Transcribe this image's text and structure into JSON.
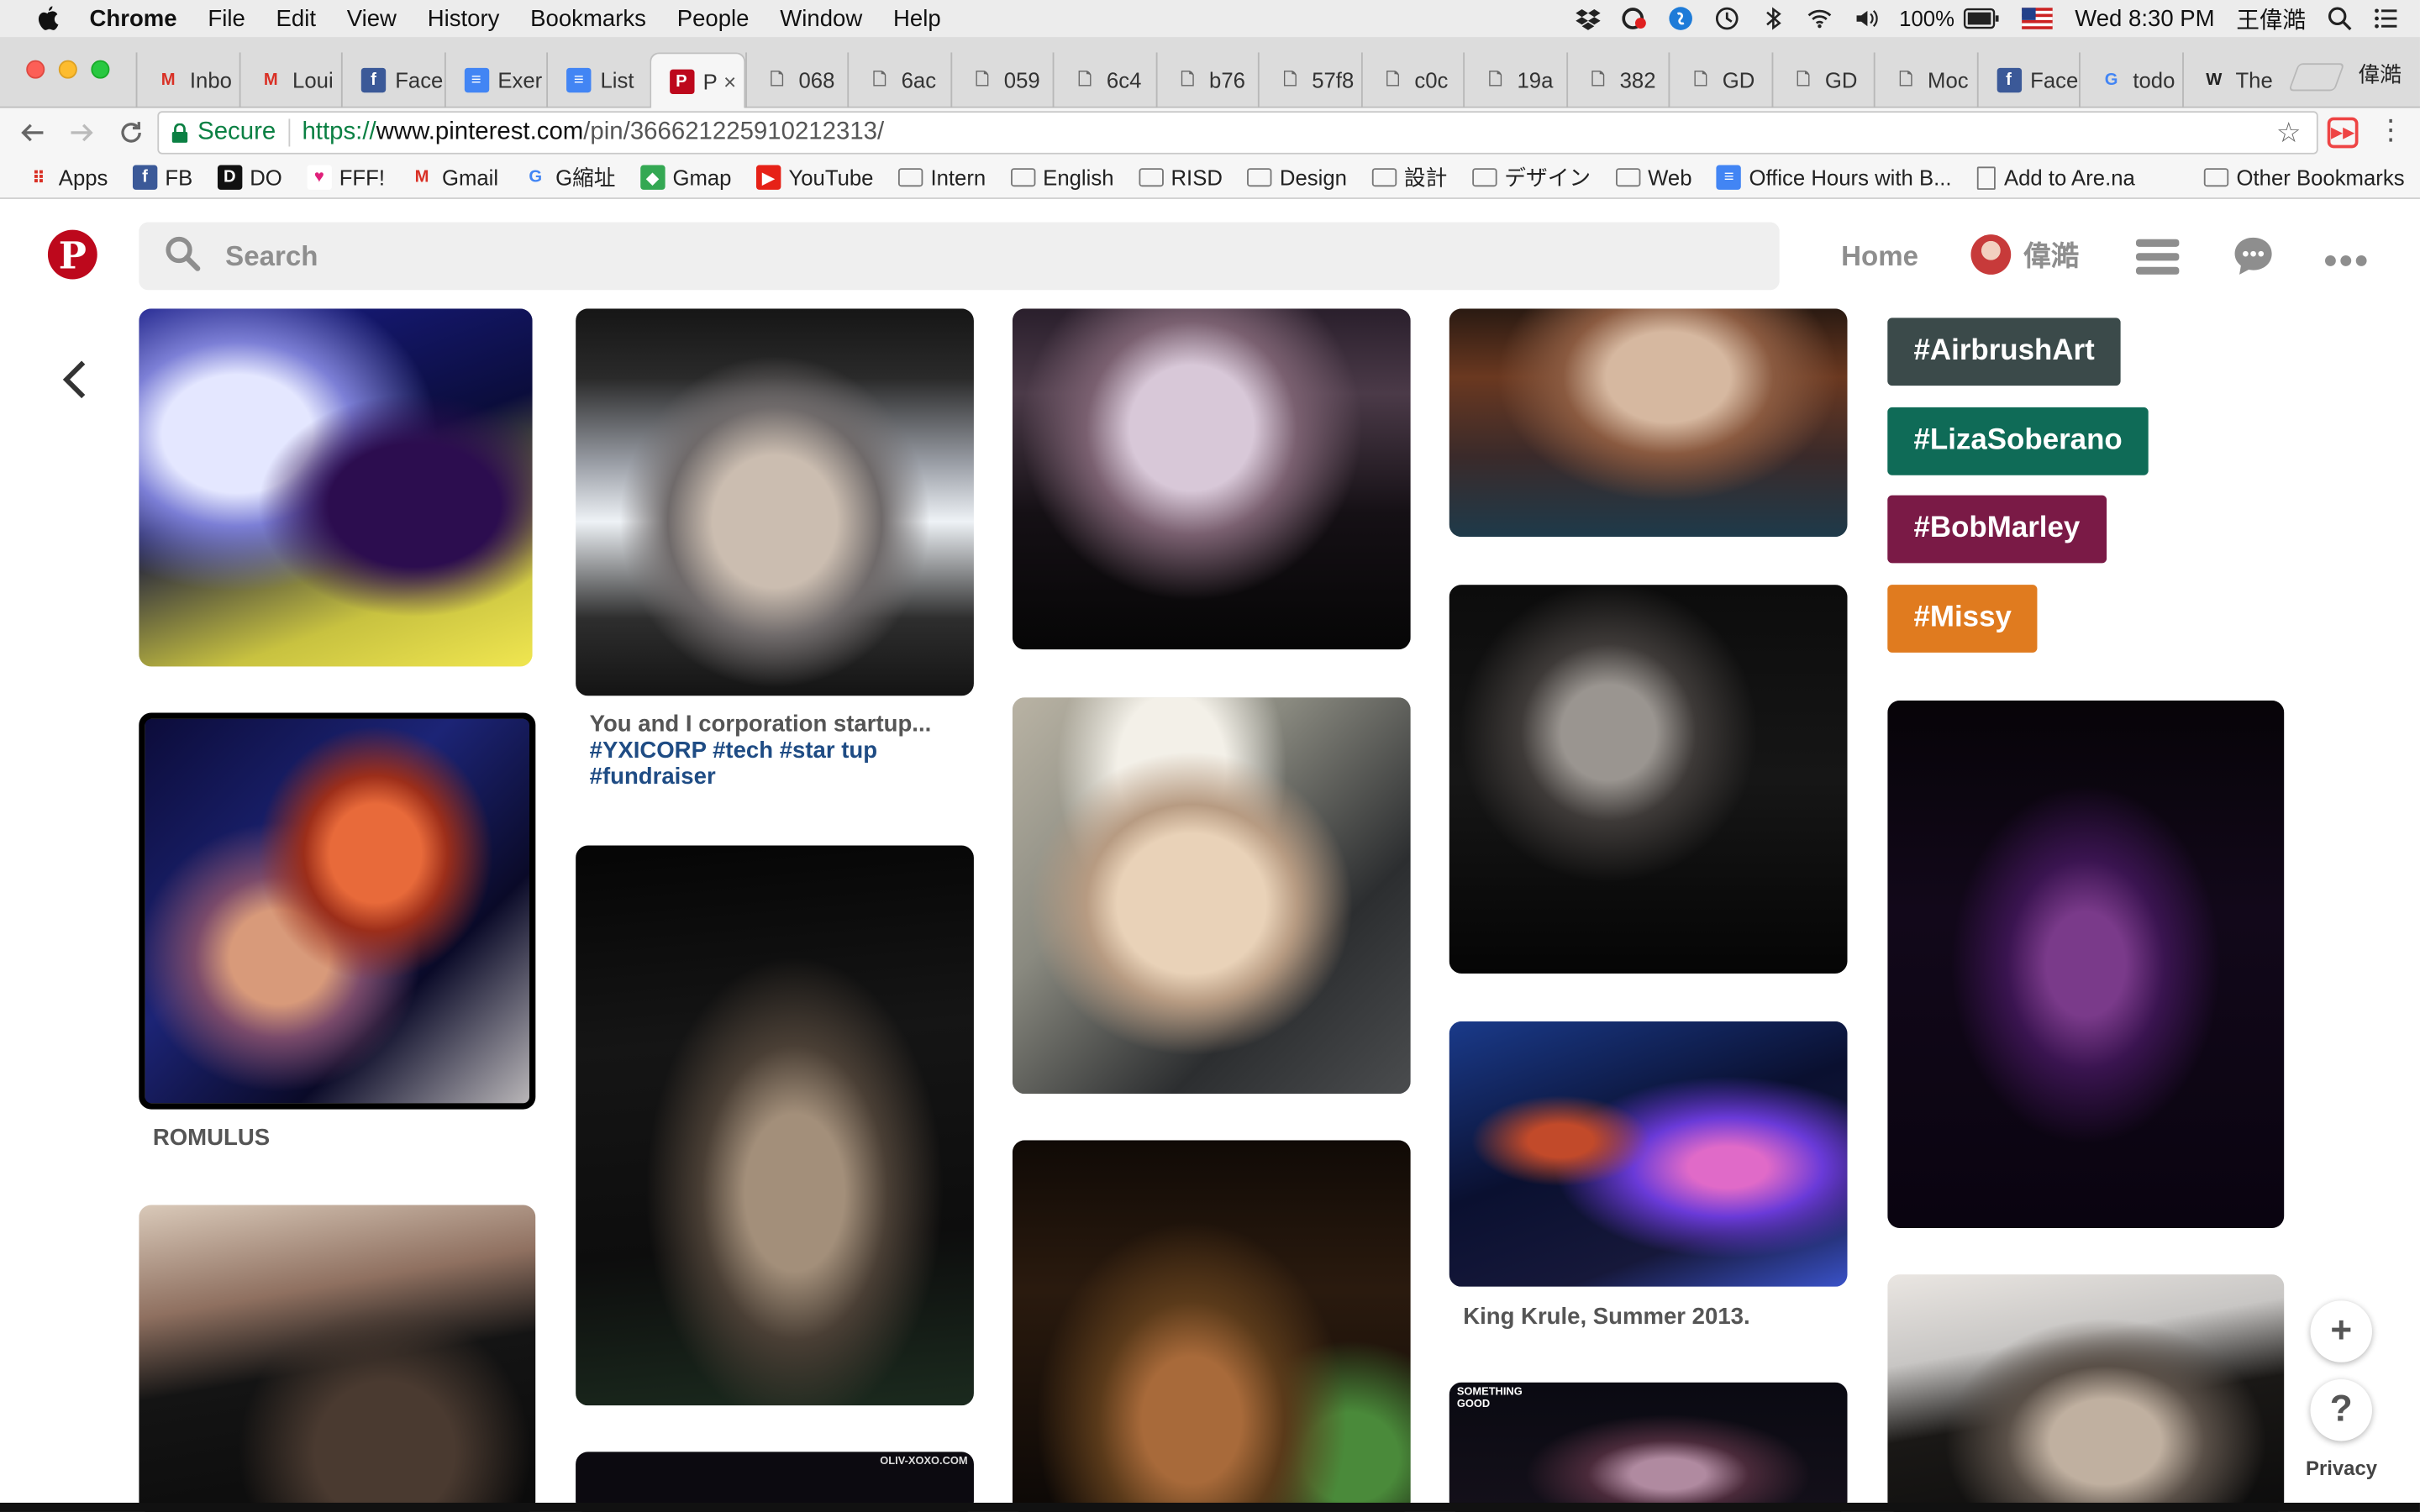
{
  "menubar": {
    "items": [
      "Chrome",
      "File",
      "Edit",
      "View",
      "History",
      "Bookmarks",
      "People",
      "Window",
      "Help"
    ],
    "battery": "100%",
    "clock": "Wed 8:30 PM",
    "user": "王偉澔"
  },
  "tabs": [
    {
      "label": "Inbo",
      "favicon": "gmail-icon"
    },
    {
      "label": "Loui",
      "favicon": "gmail-icon"
    },
    {
      "label": "Face",
      "favicon": "facebook-icon"
    },
    {
      "label": "Exer",
      "favicon": "docs-icon"
    },
    {
      "label": "List",
      "favicon": "docs-icon"
    },
    {
      "label": "P",
      "favicon": "pinterest-icon",
      "active": true
    },
    {
      "label": "068",
      "favicon": "page-icon"
    },
    {
      "label": "6ac",
      "favicon": "page-icon"
    },
    {
      "label": "059",
      "favicon": "page-icon"
    },
    {
      "label": "6c4",
      "favicon": "page-icon"
    },
    {
      "label": "b76",
      "favicon": "page-icon"
    },
    {
      "label": "57f8",
      "favicon": "page-icon"
    },
    {
      "label": "c0c",
      "favicon": "page-icon"
    },
    {
      "label": "19a",
      "favicon": "page-icon"
    },
    {
      "label": "382",
      "favicon": "page-icon"
    },
    {
      "label": "GD",
      "favicon": "page-icon"
    },
    {
      "label": "GD",
      "favicon": "page-icon"
    },
    {
      "label": "Moc",
      "favicon": "page-icon"
    },
    {
      "label": "Face",
      "favicon": "facebook-icon"
    },
    {
      "label": "todo",
      "favicon": "google-icon"
    },
    {
      "label": "The",
      "favicon": "wikipedia-icon"
    }
  ],
  "profile_name": "偉澔",
  "toolbar": {
    "secure_label": "Secure",
    "url_scheme": "https://",
    "url_host": "www.pinterest.com",
    "url_path": "/pin/366621225910212313/"
  },
  "bookmarks": [
    {
      "label": "Apps",
      "icon": "apps-grid-icon"
    },
    {
      "label": "FB",
      "icon": "facebook-icon"
    },
    {
      "label": "DO",
      "icon": "digitalocean-icon"
    },
    {
      "label": "FFF!",
      "icon": "heart-icon"
    },
    {
      "label": "Gmail",
      "icon": "gmail-icon"
    },
    {
      "label": "G縮址",
      "icon": "google-icon"
    },
    {
      "label": "Gmap",
      "icon": "maps-icon"
    },
    {
      "label": "YouTube",
      "icon": "youtube-icon"
    },
    {
      "label": "Intern",
      "icon": "folder-icon"
    },
    {
      "label": "English",
      "icon": "folder-icon"
    },
    {
      "label": "RISD",
      "icon": "folder-icon"
    },
    {
      "label": "Design",
      "icon": "folder-icon"
    },
    {
      "label": "設計",
      "icon": "folder-icon"
    },
    {
      "label": "デザイン",
      "icon": "folder-icon"
    },
    {
      "label": "Web",
      "icon": "folder-icon"
    },
    {
      "label": "Office Hours with B...",
      "icon": "docs-icon"
    },
    {
      "label": "Add to Are.na",
      "icon": "page-icon"
    }
  ],
  "other_bookmarks": "Other Bookmarks",
  "pinterest": {
    "search_placeholder": "Search",
    "nav_home": "Home",
    "nav_user": "偉澔"
  },
  "captions": {
    "pin_2": "You and I corporation startup...",
    "pin_2_tags": "#YXICORP #tech #star tup #fundraiser",
    "pin_6": "ROMULUS",
    "pin_10": "King Krule, Summer 2013.",
    "pin_11_overlay": "SOMETHING GOOD",
    "pin_12_overlay": "OLIV-XOXO.COM"
  },
  "hashtags": [
    {
      "label": "#AirbrushArt",
      "color": "#3b4a4a"
    },
    {
      "label": "#LizaSoberano",
      "color": "#0f6b57"
    },
    {
      "label": "#BobMarley",
      "color": "#7a1a46"
    },
    {
      "label": "#Missy",
      "color": "#e07b1f"
    }
  ],
  "widgets": {
    "plus": "+",
    "help": "?",
    "privacy": "Privacy"
  }
}
